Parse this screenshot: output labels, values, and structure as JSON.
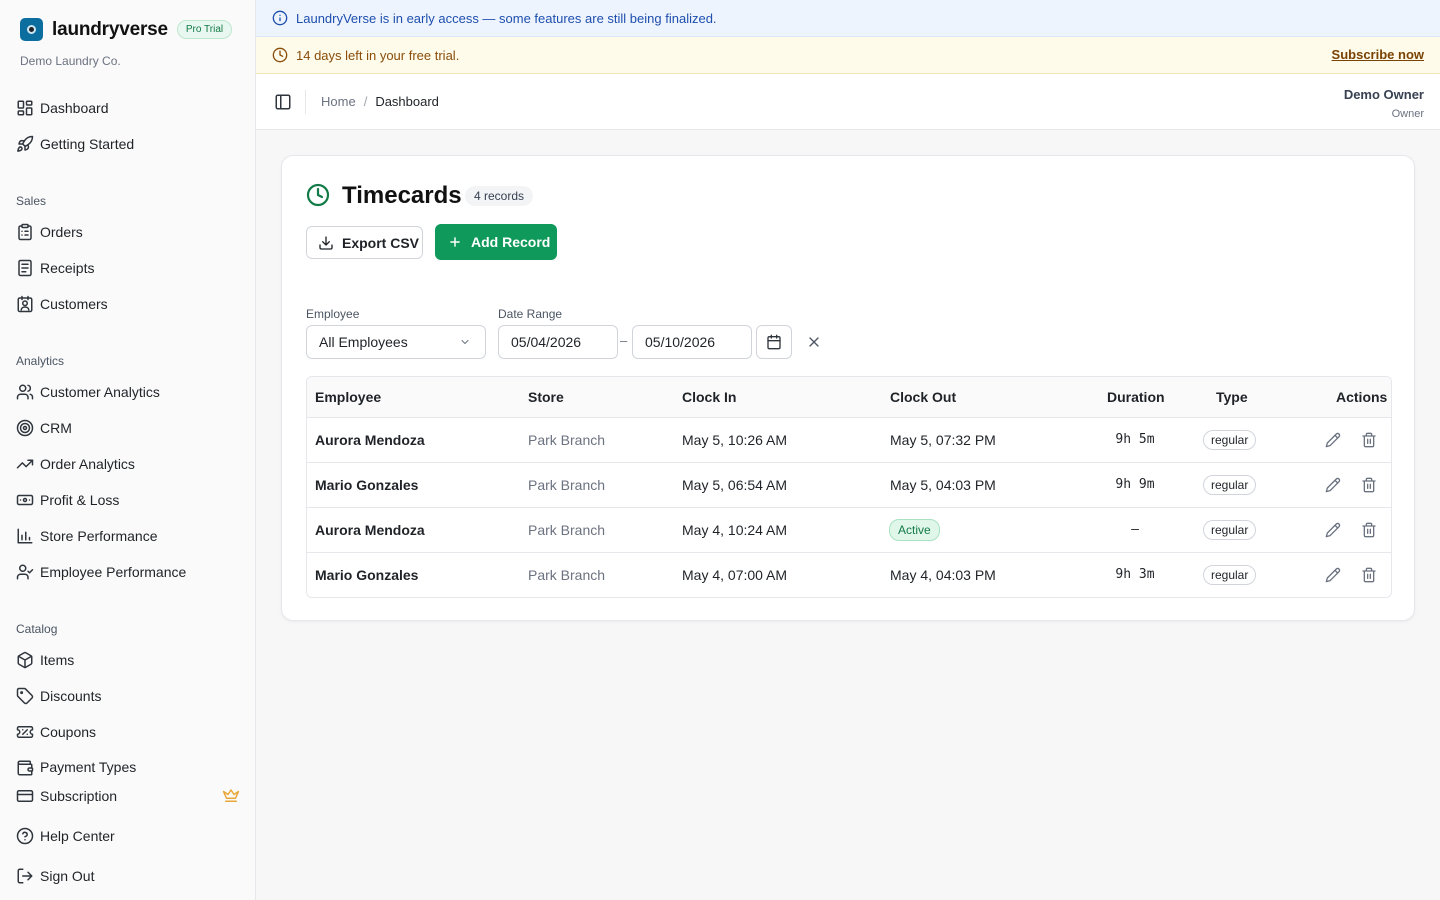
{
  "app": {
    "brand_name": "laundryverse",
    "plan_badge": "Pro Trial",
    "org_name": "Demo Laundry Co.",
    "brand_color": "#0b6e9f",
    "accent_color": "#0f9a5b"
  },
  "sidebar": {
    "top_items": [
      {
        "label": "Dashboard",
        "icon": "dashboard-icon"
      },
      {
        "label": "Getting Started",
        "icon": "rocket-icon"
      }
    ],
    "sections": [
      {
        "title": "Sales",
        "items": [
          {
            "label": "Orders",
            "icon": "clipboard-icon"
          },
          {
            "label": "Receipts",
            "icon": "receipt-icon"
          },
          {
            "label": "Customers",
            "icon": "contact-icon"
          }
        ]
      },
      {
        "title": "Analytics",
        "items": [
          {
            "label": "Customer Analytics",
            "icon": "users-icon"
          },
          {
            "label": "CRM",
            "icon": "target-icon"
          },
          {
            "label": "Order Analytics",
            "icon": "trending-up-icon"
          },
          {
            "label": "Profit & Loss",
            "icon": "banknote-icon"
          },
          {
            "label": "Store Performance",
            "icon": "bar-chart-icon"
          },
          {
            "label": "Employee Performance",
            "icon": "user-check-icon"
          }
        ]
      },
      {
        "title": "Catalog",
        "items": [
          {
            "label": "Items",
            "icon": "package-icon"
          },
          {
            "label": "Discounts",
            "icon": "tag-icon"
          },
          {
            "label": "Coupons",
            "icon": "ticket-icon"
          },
          {
            "label": "Payment Types",
            "icon": "wallet-icon"
          }
        ]
      }
    ],
    "bottom_items": [
      {
        "label": "Subscription",
        "icon": "credit-card-icon"
      },
      {
        "label": "Help Center",
        "icon": "help-circle-icon"
      },
      {
        "label": "Sign Out",
        "icon": "log-out-icon"
      }
    ]
  },
  "banners": {
    "info_text": "LaundryVerse is in early access — some features are still being finalized.",
    "trial_text": "14 days left in your free trial.",
    "subscribe_label": "Subscribe now"
  },
  "topbar": {
    "breadcrumb_home": "Home",
    "breadcrumb_separator": "/",
    "breadcrumb_current": "Dashboard",
    "user_name": "Demo Owner",
    "user_role": "Owner"
  },
  "timecards": {
    "title": "Timecards",
    "records_badge": "4 records",
    "export_label": "Export CSV",
    "add_label": "Add Record",
    "filters": {
      "employee_label": "Employee",
      "employee_value": "All Employees",
      "date_range_label": "Date Range",
      "date_from": "05/04/2026",
      "date_separator": "–",
      "date_to": "05/10/2026"
    },
    "columns": [
      "Employee",
      "Store",
      "Clock In",
      "Clock Out",
      "Duration",
      "Type",
      "Actions"
    ],
    "rows": [
      {
        "employee": "Aurora Mendoza",
        "store": "Park Branch",
        "clock_in": "May 5, 10:26 AM",
        "clock_out": "May 5, 07:32 PM",
        "duration": "9h 5m",
        "type": "regular"
      },
      {
        "employee": "Mario Gonzales",
        "store": "Park Branch",
        "clock_in": "May 5, 06:54 AM",
        "clock_out": "May 5, 04:03 PM",
        "duration": "9h 9m",
        "type": "regular"
      },
      {
        "employee": "Aurora Mendoza",
        "store": "Park Branch",
        "clock_in": "May 4, 10:24 AM",
        "clock_out_status": "Active",
        "duration": "–",
        "type": "regular"
      },
      {
        "employee": "Mario Gonzales",
        "store": "Park Branch",
        "clock_in": "May 4, 07:00 AM",
        "clock_out": "May 4, 04:03 PM",
        "duration": "9h 3m",
        "type": "regular"
      }
    ]
  }
}
